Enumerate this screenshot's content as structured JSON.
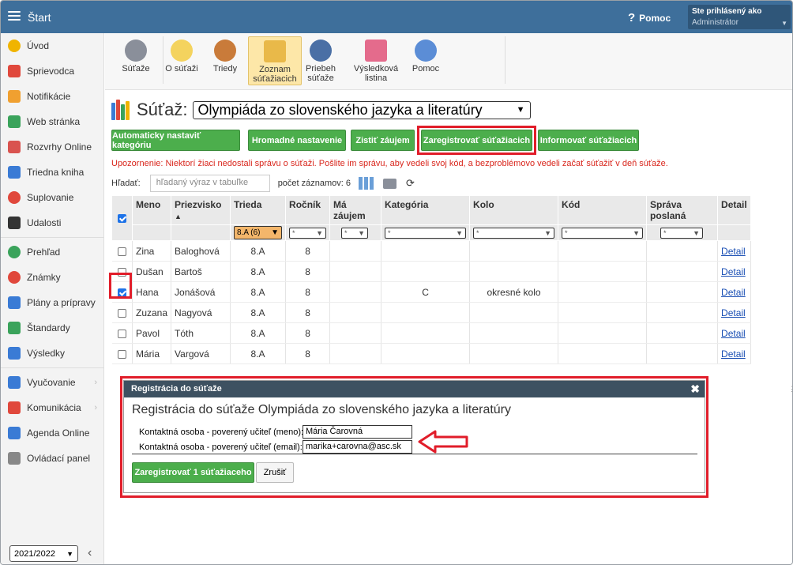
{
  "topbar": {
    "app_title": "Štart",
    "help_label": "Pomoc",
    "user_line1": "Ste prihlásený ako",
    "user_line2": "Administrátor"
  },
  "sidebar": {
    "groups": [
      [
        {
          "label": "Úvod",
          "icon": "star-icon",
          "color": "#f0b400"
        },
        {
          "label": "Sprievodca",
          "icon": "wand-icon",
          "color": "#e0483c"
        },
        {
          "label": "Notifikácie",
          "icon": "envelope-icon",
          "color": "#f0a030"
        },
        {
          "label": "Web stránka",
          "icon": "home-icon",
          "color": "#3aa35b"
        },
        {
          "label": "Rozvrhy Online",
          "icon": "timetable-icon",
          "color": "#d9534f"
        },
        {
          "label": "Triedna kniha",
          "icon": "book-icon",
          "color": "#3a7bd5"
        },
        {
          "label": "Suplovanie",
          "icon": "substitute-icon",
          "color": "#e0483c"
        },
        {
          "label": "Udalosti",
          "icon": "calendar-icon",
          "color": "#333333"
        }
      ],
      [
        {
          "label": "Prehľad",
          "icon": "check-circle-icon",
          "color": "#3aa35b"
        },
        {
          "label": "Známky",
          "icon": "grades-icon",
          "color": "#e0483c"
        },
        {
          "label": "Plány a prípravy",
          "icon": "briefcase-icon",
          "color": "#3a7bd5"
        },
        {
          "label": "Štandardy",
          "icon": "shield-icon",
          "color": "#3aa35b"
        },
        {
          "label": "Výsledky",
          "icon": "bar-chart-icon",
          "color": "#3a7bd5"
        }
      ],
      [
        {
          "label": "Vyučovanie",
          "icon": "open-book-icon",
          "color": "#3a7bd5",
          "chevron": "›"
        },
        {
          "label": "Komunikácia",
          "icon": "chat-icon",
          "color": "#e0483c",
          "chevron": "›"
        },
        {
          "label": "Agenda Online",
          "icon": "pen-icon",
          "color": "#3a7bd5"
        },
        {
          "label": "Ovládací panel",
          "icon": "gear-icon",
          "color": "#888888"
        }
      ]
    ],
    "year": "2021/2022",
    "collapse_glyph": "‹"
  },
  "toolbar": {
    "items": [
      {
        "label": "Súťaže",
        "icon": "scales-icon",
        "color": "#8a8f9a"
      },
      {
        "label": "O súťaži",
        "icon": "lightbulb-icon",
        "color": "#f4d35e"
      },
      {
        "label": "Triedy",
        "icon": "person-icon",
        "color": "#c97b3a"
      },
      {
        "label": "Zoznam súťažiacich",
        "icon": "clipboard-icon",
        "color": "#e9b949",
        "active": true
      },
      {
        "label": "Priebeh súťaže",
        "icon": "stopwatch-icon",
        "color": "#4a6fa5"
      },
      {
        "label": "Výsledková listina",
        "icon": "certificate-icon",
        "color": "#e46b8c"
      },
      {
        "label": "Pomoc",
        "icon": "question-icon",
        "color": "#5b8dd6"
      }
    ]
  },
  "competition": {
    "label": "Súťaž:",
    "selected": "Olympiáda zo slovenského jazyka a literatúry"
  },
  "actions": {
    "auto_category": "Automaticky nastaviť kategóriu",
    "bulk_settings": "Hromadné nastavenie",
    "find_interest": "Zistiť záujem",
    "register": "Zaregistrovať súťažiacich",
    "inform": "Informovať súťažiacich"
  },
  "warning": "Upozornenie: Niektorí žiaci nedostali správu o súťaži. Pošlite im správu, aby vedeli svoj kód, a bezproblémovo vedeli začať súťažiť v deň súťaže.",
  "search": {
    "label": "Hľadať:",
    "placeholder": "hľadaný výraz v tabuľke",
    "count_label": "počet záznamov: 6"
  },
  "table": {
    "headers": [
      "Meno",
      "Priezvisko",
      "Trieda",
      "Ročník",
      "Má záujem",
      "Kategória",
      "Kolo",
      "Kód",
      "Správa poslaná",
      "Detail"
    ],
    "sort_glyph": "▲",
    "filters": {
      "trieda": "8.A (6)",
      "any": "*"
    },
    "rows": [
      {
        "meno": "Zina",
        "priezvisko": "Baloghová",
        "trieda": "8.A",
        "rocnik": "8",
        "zaujem": "",
        "kategoria": "",
        "kolo": "",
        "kod": "",
        "sprava": "",
        "detail": "Detail",
        "checked": false
      },
      {
        "meno": "Dušan",
        "priezvisko": "Bartoš",
        "trieda": "8.A",
        "rocnik": "8",
        "zaujem": "",
        "kategoria": "",
        "kolo": "",
        "kod": "",
        "sprava": "",
        "detail": "Detail",
        "checked": false
      },
      {
        "meno": "Hana",
        "priezvisko": "Jonášová",
        "trieda": "8.A",
        "rocnik": "8",
        "zaujem": "",
        "kategoria": "C",
        "kolo": "okresné kolo",
        "kod": "",
        "sprava": "",
        "detail": "Detail",
        "checked": true
      },
      {
        "meno": "Zuzana",
        "priezvisko": "Nagyová",
        "trieda": "8.A",
        "rocnik": "8",
        "zaujem": "",
        "kategoria": "",
        "kolo": "",
        "kod": "",
        "sprava": "",
        "detail": "Detail",
        "checked": false
      },
      {
        "meno": "Pavol",
        "priezvisko": "Tóth",
        "trieda": "8.A",
        "rocnik": "8",
        "zaujem": "",
        "kategoria": "",
        "kolo": "",
        "kod": "",
        "sprava": "",
        "detail": "Detail",
        "checked": false
      },
      {
        "meno": "Mária",
        "priezvisko": "Vargová",
        "trieda": "8.A",
        "rocnik": "8",
        "zaujem": "",
        "kategoria": "",
        "kolo": "",
        "kod": "",
        "sprava": "",
        "detail": "Detail",
        "checked": false
      }
    ]
  },
  "modal": {
    "header": "Registrácia do súťaže",
    "close_glyph": "✖",
    "title": "Registrácia do súťaže Olympiáda zo slovenského jazyka a literatúry",
    "name_label": "Kontaktná osoba - poverený učiteľ (meno):",
    "name_value": "Mária Čarovná",
    "email_label": "Kontaktná osoba - poverený učiteľ (email):",
    "email_value": "marika+carovna@asc.sk",
    "register_button": "Zaregistrovať 1 súťažiaceho",
    "cancel_button": "Zrušiť"
  },
  "colors": {
    "topbar": "#3e6f9b",
    "green": "#4cae4c",
    "highlight": "#e11d2a",
    "warning": "#d9261c",
    "link": "#1a4fb4"
  }
}
